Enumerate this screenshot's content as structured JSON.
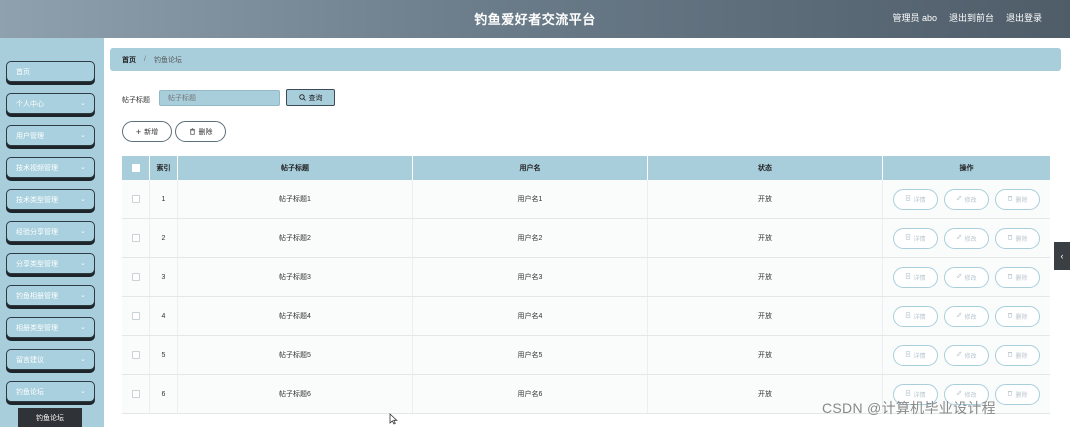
{
  "header": {
    "title": "钓鱼爱好者交流平台",
    "user": "管理员 abo",
    "to_front": "退出到前台",
    "logout": "退出登录"
  },
  "sidebar": {
    "items": [
      {
        "label": "首页",
        "has_chevron": false
      },
      {
        "label": "个人中心",
        "has_chevron": true
      },
      {
        "label": "用户管理",
        "has_chevron": true
      },
      {
        "label": "技术视频管理",
        "has_chevron": true
      },
      {
        "label": "技术类型管理",
        "has_chevron": true
      },
      {
        "label": "经验分享管理",
        "has_chevron": true
      },
      {
        "label": "分享类型管理",
        "has_chevron": true
      },
      {
        "label": "钓鱼相册管理",
        "has_chevron": true
      },
      {
        "label": "相册类型管理",
        "has_chevron": true
      },
      {
        "label": "留言建议",
        "has_chevron": true
      },
      {
        "label": "钓鱼论坛",
        "has_chevron": true
      }
    ],
    "submenu_active": "钓鱼论坛"
  },
  "breadcrumb": {
    "home": "首页",
    "current": "钓鱼论坛"
  },
  "search": {
    "label": "帖子标题",
    "placeholder": "帖子标题",
    "button": "查询"
  },
  "actions": {
    "add": "新增",
    "delete": "删除"
  },
  "table": {
    "columns": [
      "索引",
      "帖子标题",
      "用户名",
      "状态",
      "操作"
    ],
    "rows": [
      {
        "index": "1",
        "title": "帖子标题1",
        "username": "用户名1",
        "status": "开放"
      },
      {
        "index": "2",
        "title": "帖子标题2",
        "username": "用户名2",
        "status": "开放"
      },
      {
        "index": "3",
        "title": "帖子标题3",
        "username": "用户名3",
        "status": "开放"
      },
      {
        "index": "4",
        "title": "帖子标题4",
        "username": "用户名4",
        "status": "开放"
      },
      {
        "index": "5",
        "title": "帖子标题5",
        "username": "用户名5",
        "status": "开放"
      },
      {
        "index": "6",
        "title": "帖子标题6",
        "username": "用户名6",
        "status": "开放"
      }
    ],
    "row_actions": {
      "detail": "详情",
      "edit": "修改",
      "delete": "删除"
    }
  },
  "watermark": "CSDN @计算机毕业设计程",
  "icons": {
    "search": "search-icon",
    "plus": "plus-icon",
    "trash": "trash-icon",
    "detail": "document-icon",
    "edit": "edit-icon",
    "chevron": "chevron-down-icon",
    "toggle": "chevron-left-icon",
    "cursor": "mouse-cursor-icon"
  },
  "colors": {
    "accent": "#a8cedc",
    "header_dark": "#4f5d69",
    "border_dark": "#2f3a42"
  }
}
